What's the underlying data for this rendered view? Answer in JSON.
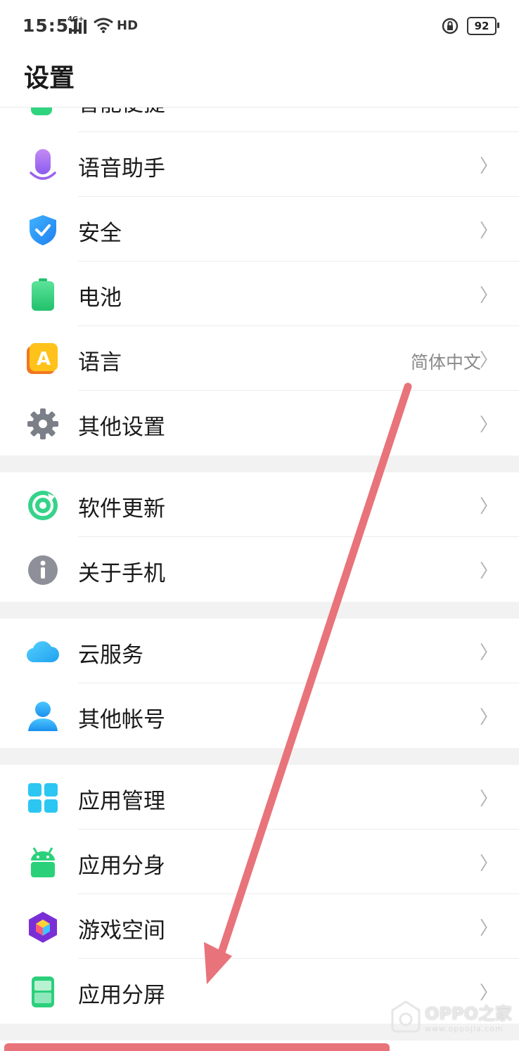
{
  "status": {
    "time": "15:51",
    "network": "4G+",
    "hd": "HD",
    "battery": "92"
  },
  "header": {
    "title": "设置"
  },
  "partial_item": {
    "label": "智能便捷"
  },
  "groups": [
    {
      "items": [
        {
          "label": "语音助手",
          "icon": "microphone-icon"
        },
        {
          "label": "安全",
          "icon": "shield-icon"
        },
        {
          "label": "电池",
          "icon": "battery-icon"
        },
        {
          "label": "语言",
          "value": "简体中文",
          "icon": "language-icon"
        },
        {
          "label": "其他设置",
          "icon": "gear-icon"
        }
      ]
    },
    {
      "items": [
        {
          "label": "软件更新",
          "icon": "update-icon"
        },
        {
          "label": "关于手机",
          "icon": "info-icon"
        }
      ]
    },
    {
      "items": [
        {
          "label": "云服务",
          "icon": "cloud-icon"
        },
        {
          "label": "其他帐号",
          "icon": "user-icon"
        }
      ]
    },
    {
      "items": [
        {
          "label": "应用管理",
          "icon": "app-grid-icon"
        },
        {
          "label": "应用分身",
          "icon": "android-icon"
        },
        {
          "label": "游戏空间",
          "icon": "game-cube-icon"
        },
        {
          "label": "应用分屏",
          "icon": "split-screen-icon"
        }
      ]
    }
  ],
  "chevron": "〉",
  "watermark": {
    "main": "OPPO之家",
    "sub": "www.oppojia.com"
  },
  "colors": {
    "annotation_arrow": "#e8737a",
    "divider_gap": "#f2f2f2"
  }
}
